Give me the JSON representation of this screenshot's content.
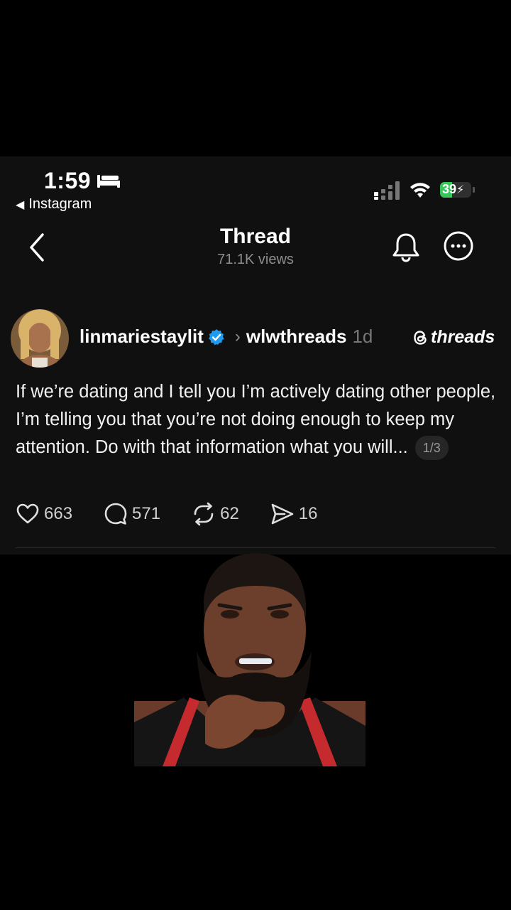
{
  "status_bar": {
    "time": "1:59",
    "back_app": "Instagram",
    "battery_level": "39",
    "battery_fraction": 0.39,
    "battery_color": "#35c759"
  },
  "header": {
    "title": "Thread",
    "views": "71.1K views",
    "icons": [
      "back-chevron-icon",
      "bell-icon",
      "more-icon"
    ]
  },
  "post": {
    "author": "linmariestaylit",
    "reposted_from": "wlwthreads",
    "age": "1d",
    "brand": "threads",
    "text": "If we’re dating and I tell you I’m actively dating other people, I’m telling you that you’re not doing enough to keep my attention. Do with that information what you will...",
    "page_indicator": "1/3",
    "actions": {
      "likes": "663",
      "comments": "571",
      "reposts": "62",
      "shares": "16"
    }
  },
  "colors": {
    "background": "#000000",
    "screen": "#101010",
    "verified": "#1d9bf0",
    "muted": "#8e8e8e"
  }
}
